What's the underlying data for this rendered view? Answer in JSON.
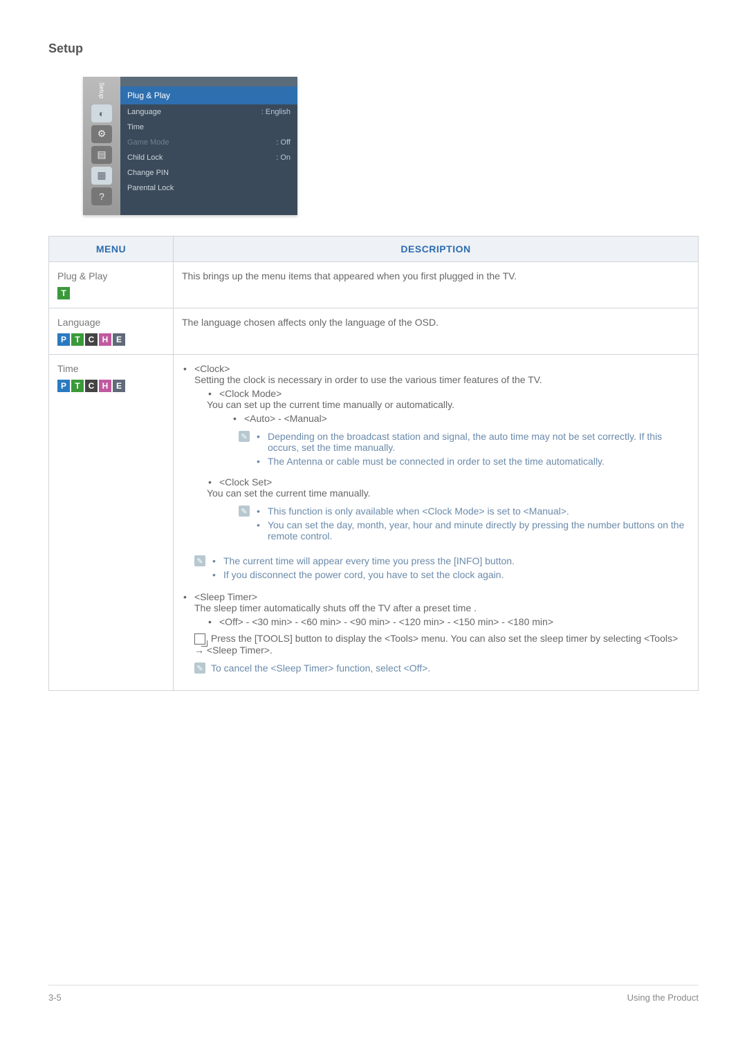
{
  "section_title": "Setup",
  "menu_shot": {
    "sidebar_label": "Setup",
    "heading": "Plug & Play",
    "rows": [
      {
        "label": "Language",
        "value": ": English",
        "dim": false
      },
      {
        "label": "Time",
        "value": "",
        "dim": false
      },
      {
        "label": "Game Mode",
        "value": ": Off",
        "dim": true
      },
      {
        "label": "Child Lock",
        "value": ": On",
        "dim": false
      },
      {
        "label": "Change PIN",
        "value": "",
        "dim": false
      },
      {
        "label": "Parental Lock",
        "value": "",
        "dim": false
      }
    ]
  },
  "table": {
    "head_menu": "MENU",
    "head_desc": "DESCRIPTION",
    "rows": {
      "plugplay": {
        "name": "Plug & Play",
        "badges": [
          "T"
        ],
        "desc": "This brings up the menu items that appeared when you first plugged in the TV."
      },
      "language": {
        "name": "Language",
        "badges": [
          "P",
          "T",
          "C",
          "H",
          "E"
        ],
        "desc": "The language chosen affects only the language of the OSD."
      },
      "time": {
        "name": "Time",
        "badges": [
          "P",
          "T",
          "C",
          "H",
          "E"
        ],
        "clock": {
          "title": "<Clock>",
          "intro": "Setting the clock is necessary in order to use the various timer features of the TV.",
          "clockmode": {
            "title": "<Clock Mode>",
            "text": "You can set up the current time manually or automatically.",
            "options": "<Auto> - <Manual>",
            "notes": [
              "Depending on the broadcast station and signal, the auto time may not be set correctly. If this occurs, set the time manually.",
              "The Antenna or cable must be connected in order to set the time automatically."
            ]
          },
          "clockset": {
            "title": "<Clock Set>",
            "text": "You can set the current time manually.",
            "notes": [
              "This function is only available when <Clock Mode> is set to <Manual>.",
              "You can set the day, month, year, hour and minute directly by pressing the number buttons on the remote control."
            ]
          },
          "mid_notes": [
            "The current time will appear every time you press the [INFO] button.",
            "If you disconnect the power cord, you have to set the clock again."
          ]
        },
        "sleep": {
          "title": "<Sleep Timer>",
          "intro": "The sleep timer automatically shuts off the TV after a preset time .",
          "options": "<Off> - <30 min> - <60 min> - <90 min> - <120 min> - <150 min> - <180 min>",
          "tools": "Press the [TOOLS] button to display the <Tools> menu. You can also set the sleep timer by selecting <Tools> → <Sleep Timer>.",
          "cancel": "To cancel the <Sleep Timer> function, select <Off>."
        }
      }
    }
  },
  "footer": {
    "left": "3-5",
    "right": "Using the Product"
  }
}
